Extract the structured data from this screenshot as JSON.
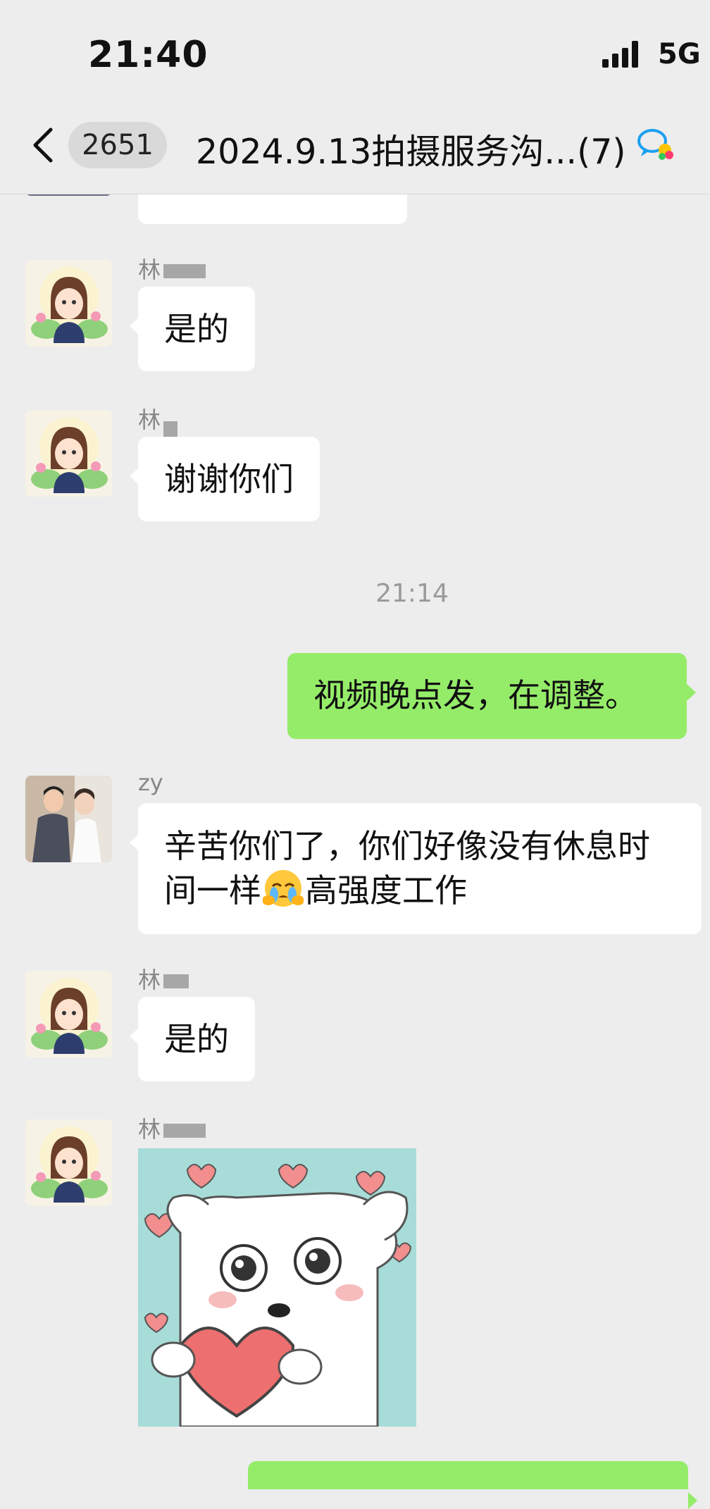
{
  "status_bar": {
    "time": "21:40",
    "network": "5G"
  },
  "header": {
    "unread_count": "2651",
    "title": "2024.9.13拍摄服务沟...(7)"
  },
  "messages": [
    {
      "type": "text",
      "side": "left",
      "sender": "",
      "text": ""
    },
    {
      "type": "text",
      "side": "left",
      "sender": "林",
      "text": "是的"
    },
    {
      "type": "text",
      "side": "left",
      "sender": "林",
      "text": "谢谢你们"
    },
    {
      "type": "timestamp",
      "text": "21:14"
    },
    {
      "type": "text",
      "side": "right",
      "text": "视频晚点发，在调整。"
    },
    {
      "type": "text",
      "side": "left",
      "sender": "zy",
      "text": "辛苦你们了，你们好像没有休息时间一样",
      "text_after_emoji": "高强度工作",
      "emoji": "face-holding-back-tears"
    },
    {
      "type": "text",
      "side": "left",
      "sender": "林",
      "text": "是的"
    },
    {
      "type": "sticker",
      "side": "left",
      "sender": "林",
      "sticker": "dog-hugging-heart"
    }
  ],
  "colors": {
    "background": "#ededed",
    "bubble_self": "#95ec69",
    "bubble_other": "#ffffff"
  }
}
